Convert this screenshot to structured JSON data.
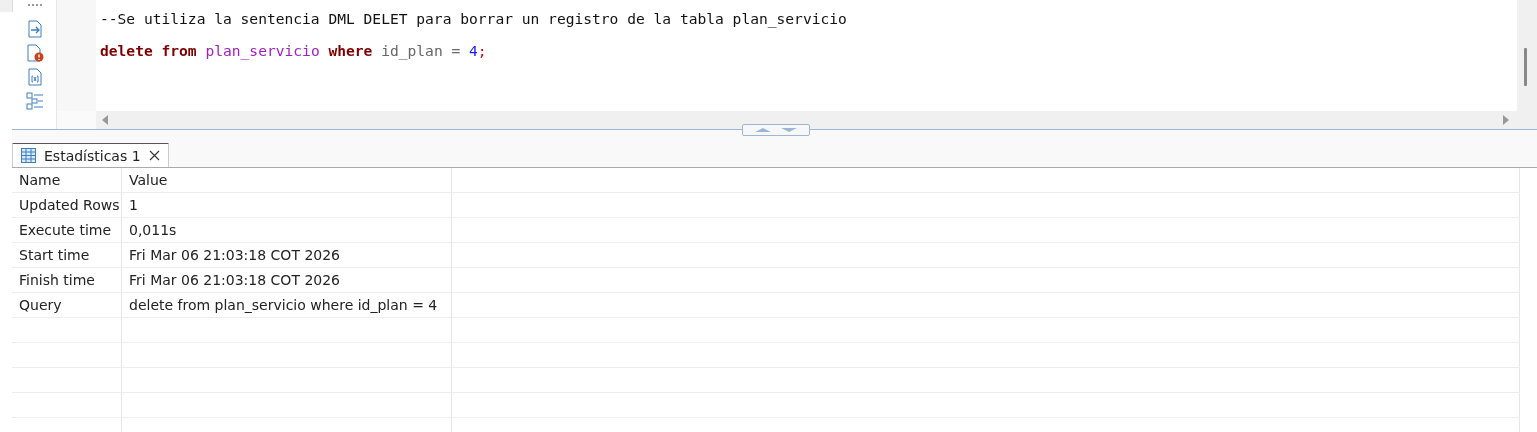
{
  "editor": {
    "lines": [
      {
        "tokens": [
          {
            "text": "--Se utiliza la sentencia DML DELET para borrar un registro de la tabla plan_servicio",
            "kind": "comment"
          }
        ]
      },
      {
        "tokens": [
          {
            "text": "delete",
            "kind": "keyword"
          },
          {
            "text": " from",
            "kind": "keyword"
          },
          {
            "text": " plan_servicio",
            "kind": "table"
          },
          {
            "text": " where",
            "kind": "keyword"
          },
          {
            "text": " id_plan =",
            "kind": "plain"
          },
          {
            "text": " 4",
            "kind": "number"
          },
          {
            "text": ";",
            "kind": "punct"
          }
        ]
      }
    ]
  },
  "results": {
    "tabs": [
      {
        "label": "Estadísticas 1",
        "selected": true
      }
    ],
    "table": {
      "columns": [
        "Name",
        "Value"
      ],
      "rows": [
        [
          "Updated Rows",
          "1"
        ],
        [
          "Execute time",
          "0,011s"
        ],
        [
          "Start time",
          "Fri Mar 06 21:03:18 COT 2026"
        ],
        [
          "Finish time",
          "Fri Mar 06 21:03:18 COT 2026"
        ],
        [
          "Query",
          "delete from plan_servicio where id_plan = 4"
        ]
      ]
    }
  }
}
